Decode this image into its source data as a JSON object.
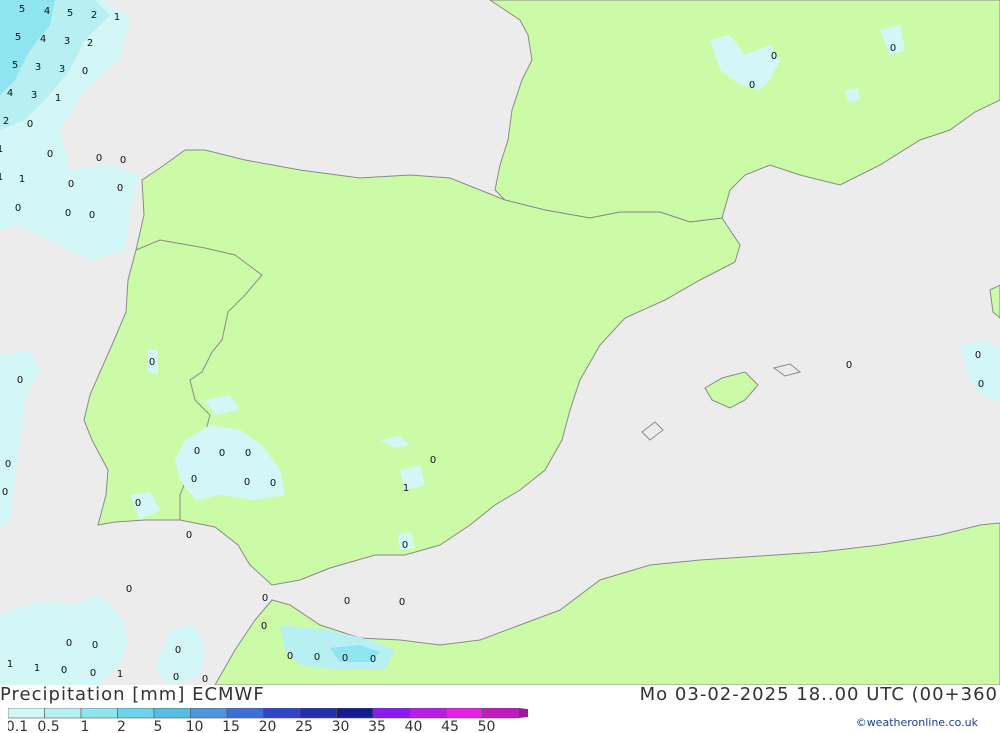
{
  "header": {
    "title": "Precipitation [mm] ECMWF",
    "timestamp": "Mo 03-02-2025 18..00 UTC (00+360"
  },
  "legend": {
    "labels": [
      "0.1",
      "0.5",
      "1",
      "2",
      "5",
      "10",
      "15",
      "20",
      "25",
      "30",
      "35",
      "40",
      "45",
      "50"
    ],
    "colors": [
      "#d3f7f7",
      "#b7eff3",
      "#8fe5ef",
      "#6dd5ea",
      "#58bde4",
      "#4d96dc",
      "#3f6ed6",
      "#2f45c8",
      "#2230b0",
      "#151c92",
      "#8a1cf0",
      "#b61ee8",
      "#e61ee6",
      "#c21abf",
      "#a0169f"
    ]
  },
  "credit": "©weatheronline.co.uk",
  "colors": {
    "sea": "#ececec",
    "land": "#ccfba8",
    "border": "#8a8a8a",
    "light_precip": "#d3f7f7",
    "medium_precip": "#8fe5ef"
  },
  "map_values": [
    "5",
    "4",
    "5",
    "2",
    "1",
    "5",
    "4",
    "3",
    "2",
    "5",
    "3",
    "3",
    "0",
    "4",
    "3",
    "1",
    "2",
    "0",
    "1",
    "0",
    "0",
    "0",
    "1",
    "1",
    "0",
    "0",
    "0",
    "0",
    "0",
    "0",
    "0",
    "0",
    "0",
    "0",
    "0",
    "0",
    "0",
    "0",
    "1",
    "0",
    "0",
    "0",
    "0",
    "0",
    "0",
    "0",
    "0",
    "0",
    "0",
    "0",
    "0",
    "0",
    "0",
    "0",
    "0",
    "0",
    "1",
    "1",
    "0",
    "0",
    "1",
    "0",
    "0",
    "0",
    "0",
    "0",
    "0",
    "0",
    "0",
    "0",
    "0"
  ]
}
